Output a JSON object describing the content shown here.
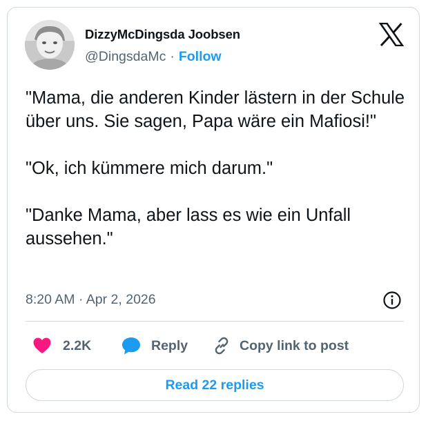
{
  "tweet": {
    "author": {
      "display_name": "DizzyMcDingsda Joobsen",
      "handle": "@DingsdaMc",
      "separator": "·",
      "follow_label": "Follow"
    },
    "text": "\"Mama, die anderen Kinder lästern in der Schule über uns. Sie sagen, Papa wäre ein Mafiosi!\"\n\n\"Ok, ich kümmere mich darum.\"\n\n\"Danke Mama, aber lass es wie ein Unfall aussehen.\"",
    "timestamp": "8:20 AM · Apr 2, 2026",
    "actions": {
      "like_count": "2.2K",
      "reply_label": "Reply",
      "copy_link_label": "Copy link to post"
    },
    "read_replies_label": "Read 22 replies"
  },
  "icons": {
    "platform_logo": "x-logo-icon",
    "like": "heart-icon",
    "reply": "speech-bubble-icon",
    "copy_link": "link-icon",
    "info": "info-icon"
  },
  "colors": {
    "accent": "#1d9bf0",
    "like": "#f91880",
    "text_primary": "#0f1419",
    "text_secondary": "#536471",
    "border": "#cfd9de"
  }
}
